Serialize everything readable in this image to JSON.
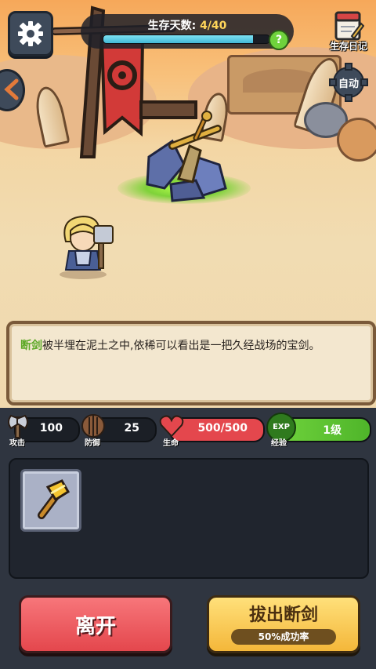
{
  "hud": {
    "survival_label": "生存天数:",
    "survival_value": "4/40",
    "survival_progress": 0.9,
    "help_symbol": "?",
    "diary_label": "生存日记",
    "auto_label": "自动"
  },
  "dialog": {
    "keyword": "断剑",
    "text": "被半埋在泥土之中,依稀可以看出是一把久经战场的宝剑。"
  },
  "stats": {
    "attack": {
      "value": "100",
      "label": "攻击"
    },
    "defense": {
      "value": "25",
      "label": "防御"
    },
    "life": {
      "value": "500/500",
      "label": "生命"
    },
    "exp": {
      "badge": "EXP",
      "value": "1级",
      "label": "经验"
    }
  },
  "inventory": {
    "items": [
      {
        "icon": "golden-hammer-icon"
      }
    ]
  },
  "actions": {
    "leave_label": "离开",
    "pull_label": "拔出断剑",
    "pull_rate": "50%成功率"
  },
  "colors": {
    "accent_green": "#5ca826",
    "life_red": "#e4474d",
    "exp_green": "#6fd23c",
    "gold": "#f4b73a"
  }
}
